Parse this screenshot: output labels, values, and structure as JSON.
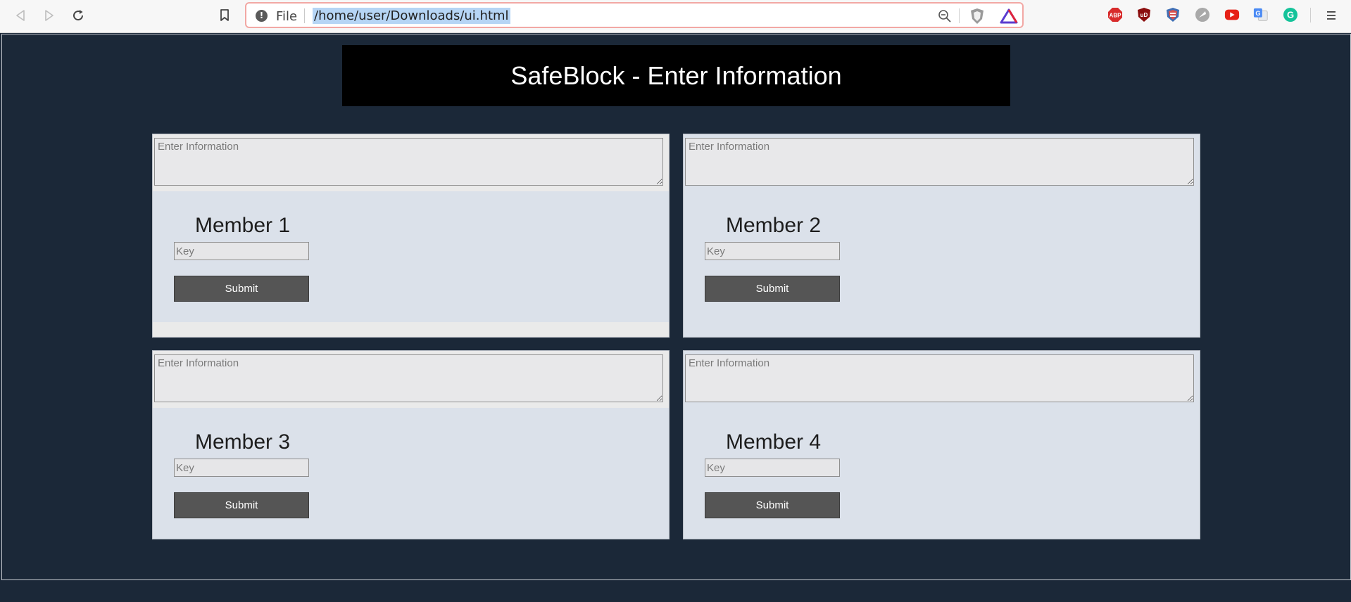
{
  "browser": {
    "url_scheme_label": "File",
    "url": "/home/user/Downloads/ui.html",
    "extensions": [
      {
        "name": "adblock-plus-icon",
        "label": "ABP",
        "color": "#d82b2b"
      },
      {
        "name": "ublock-origin-icon",
        "label": "uD",
        "color": "#8b0e0e"
      },
      {
        "name": "privacy-shield-icon",
        "label": "",
        "color": "#d9534f"
      },
      {
        "name": "gray-extension-icon",
        "label": "",
        "color": "#a9a9a9"
      },
      {
        "name": "youtube-extension-icon",
        "label": "",
        "color": "#e62117"
      },
      {
        "name": "google-translate-icon",
        "label": "G",
        "color": "#4a8af4"
      },
      {
        "name": "grammarly-icon",
        "label": "G",
        "color": "#15c39a"
      }
    ]
  },
  "page": {
    "title": "SafeBlock - Enter Information"
  },
  "members": [
    {
      "title": "Member 1",
      "info_placeholder": "Enter Information",
      "key_placeholder": "Key",
      "submit_label": "Submit"
    },
    {
      "title": "Member 2",
      "info_placeholder": "Enter Information",
      "key_placeholder": "Key",
      "submit_label": "Submit"
    },
    {
      "title": "Member 3",
      "info_placeholder": "Enter Information",
      "key_placeholder": "Key",
      "submit_label": "Submit"
    },
    {
      "title": "Member 4",
      "info_placeholder": "Enter Information",
      "key_placeholder": "Key",
      "submit_label": "Submit"
    }
  ],
  "colors": {
    "page_background": "#1b2838",
    "header_background": "#000000",
    "card_background": "#eaeaea",
    "member_panel_background": "#dbe1ea",
    "button_background": "#555555"
  }
}
